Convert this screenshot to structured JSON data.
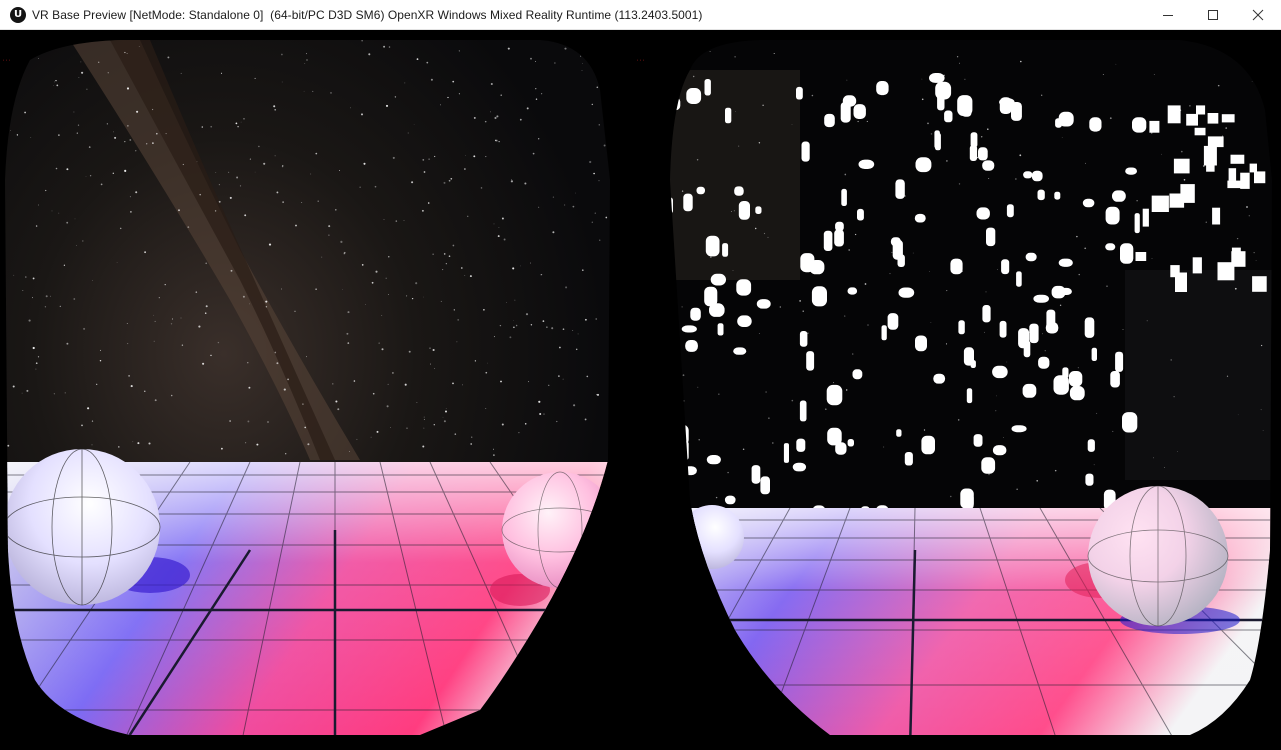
{
  "window": {
    "title": "VR Base Preview [NetMode: Standalone 0]  (64-bit/PC D3D SM6) OpenXR Windows Mixed Reality Runtime (113.2403.5001)",
    "app_icon": "unreal-engine-icon",
    "controls": {
      "minimize": "minimize-icon",
      "maximize": "maximize-icon",
      "close": "close-icon"
    }
  },
  "viewport": {
    "left_eye": {
      "sky": "milky-way-starfield",
      "floor": "grid-floor",
      "objects": [
        "sphere",
        "sphere"
      ]
    },
    "right_eye": {
      "sky": "starfield-with-white-artifacts",
      "floor": "grid-floor",
      "objects": [
        "sphere",
        "sphere"
      ]
    },
    "stat_left": "···",
    "stat_right": "···",
    "colors": {
      "floor_blue": "#6a5cff",
      "floor_pink": "#ff3f9e",
      "floor_white": "#e9e9ee",
      "grid_line": "#1a1a1a",
      "title_bar": "#ffffff"
    }
  }
}
